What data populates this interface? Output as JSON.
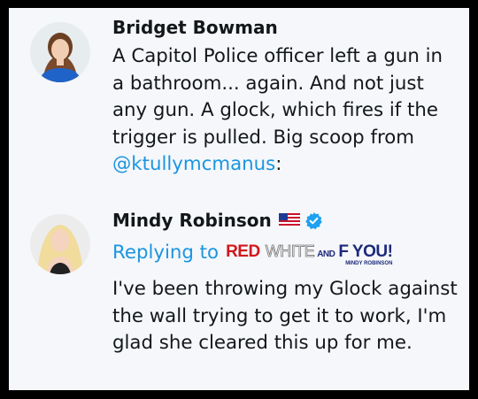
{
  "posts": [
    {
      "author": "Bridget Bowman",
      "text": "A Capitol Police officer left a gun in a bathroom... again. And not just any gun. A glock, which fires if the trigger is pulled. Big scoop from ",
      "mention": "@ktullymcmanus",
      "text_end": ":"
    },
    {
      "author": "Mindy Robinson",
      "reply_label": "Replying to",
      "banner": {
        "red": "RED",
        "white": "WHITE",
        "and": "AND",
        "f": "F YOU!",
        "sub": "MINDY ROBINSON"
      },
      "text": "I've been throwing my Glock against the wall trying to get it to work, I'm glad she cleared this up for me."
    }
  ],
  "icons": {
    "flag": "us-flag-icon",
    "verified": "verified-badge-icon"
  },
  "colors": {
    "link": "#1b95e0",
    "text": "#14171a",
    "background": "#f5f7fa",
    "border": "#000000"
  }
}
